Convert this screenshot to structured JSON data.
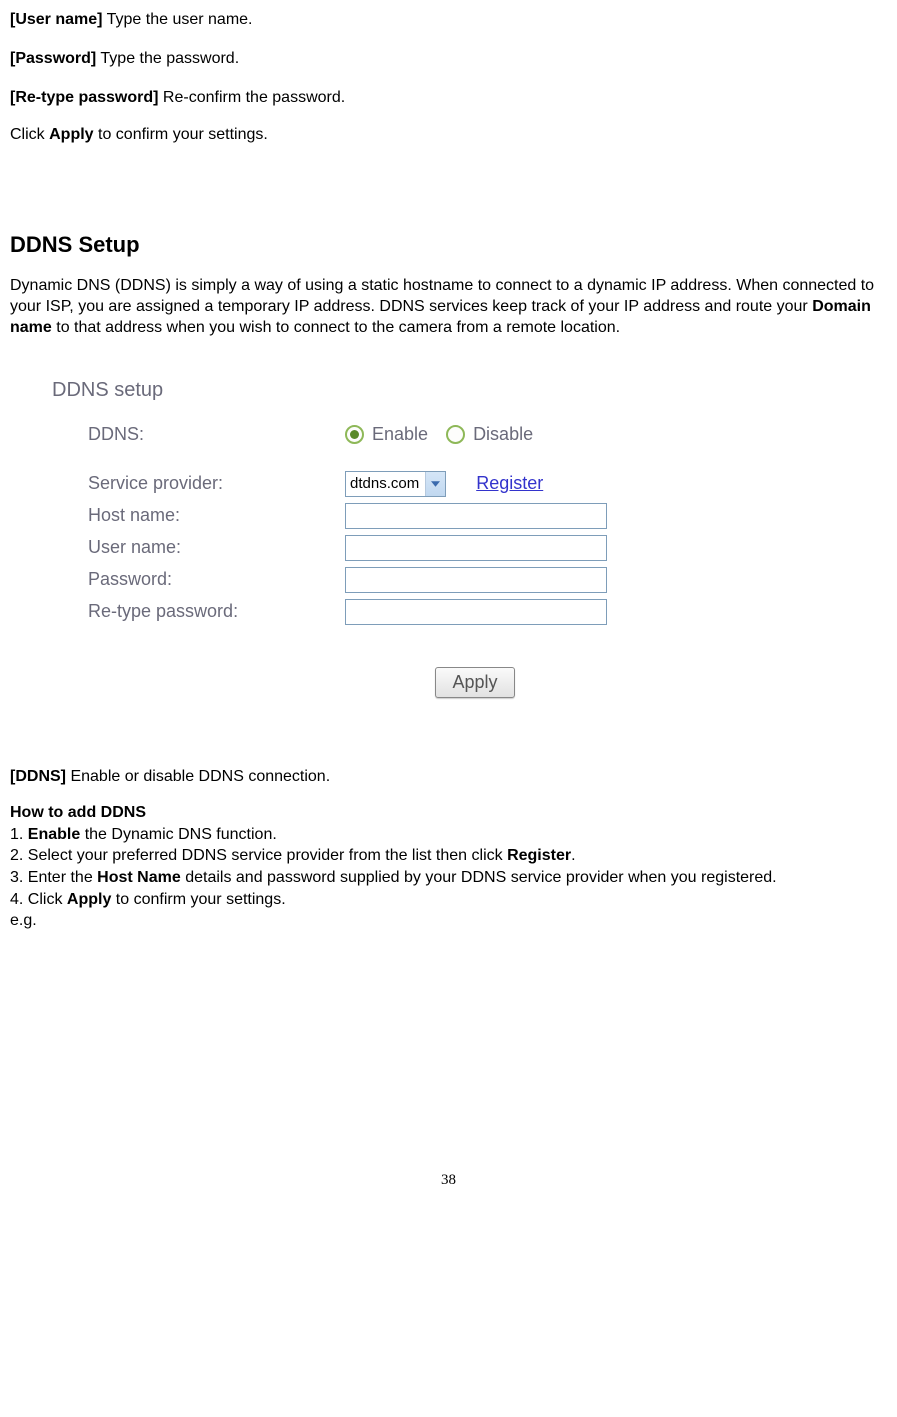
{
  "fields": {
    "username": {
      "label": "[User name]",
      "desc": " Type the user name."
    },
    "password": {
      "label": "[Password]",
      "desc": " Type the password."
    },
    "retype": {
      "label": "[Re-type password]",
      "desc": " Re-confirm the password."
    }
  },
  "clickApply": {
    "prefix": "Click ",
    "bold": "Apply",
    "suffix": " to confirm your settings."
  },
  "section": {
    "title": "DDNS Setup",
    "desc": {
      "pre": "Dynamic DNS (DDNS) is simply a way of using a static hostname to connect to a dynamic IP address. When connected to your ISP, you are assigned a temporary IP address. DDNS services keep track of your IP address and route your ",
      "bold": "Domain name",
      "post": " to that address when you wish to connect to the camera from a remote location."
    }
  },
  "screenshot": {
    "title": "DDNS setup",
    "ddnsLabel": "DDNS:",
    "enableLabel": "Enable",
    "disableLabel": "Disable",
    "serviceProviderLabel": "Service provider:",
    "serviceProviderValue": "dtdns.com",
    "registerLabel": "Register",
    "hostnameLabel": "Host name:",
    "usernameLabel": "User name:",
    "passwordLabel": "Password:",
    "retypeLabel": "Re-type password:",
    "applyLabel": "Apply"
  },
  "ddnsDesc": {
    "label": "[DDNS]",
    "desc": " Enable or disable DDNS connection."
  },
  "howto": {
    "title": "How to add DDNS",
    "step1": {
      "num": "1. ",
      "bold": "Enable",
      "rest": " the Dynamic DNS function."
    },
    "step2": {
      "num": "2. Select your preferred DDNS service provider from the list then click ",
      "bold": "Register",
      "rest": "."
    },
    "step3": {
      "pre": "3. Enter the ",
      "bold": "Host Name",
      "rest": " details and password supplied by your DDNS service provider when you registered."
    },
    "step4": {
      "pre": "4. Click ",
      "bold": "Apply",
      "rest": " to confirm your settings."
    },
    "eg": "e.g."
  },
  "pageNumber": "38"
}
